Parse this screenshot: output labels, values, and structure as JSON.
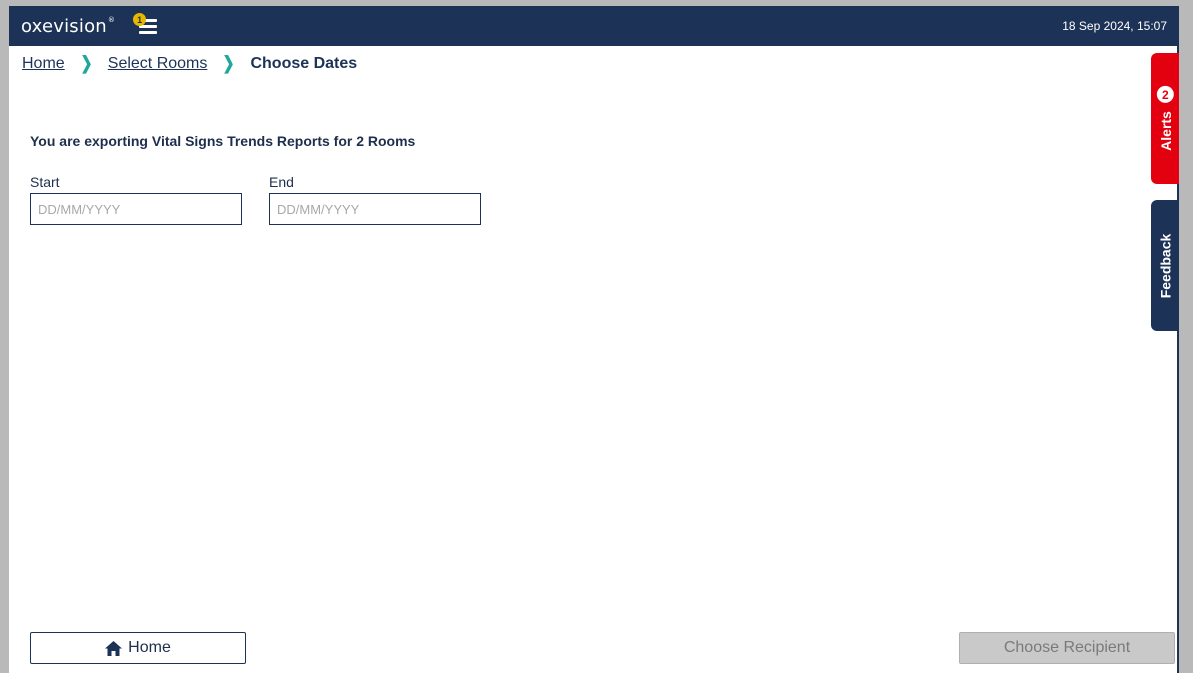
{
  "header": {
    "logo_text": "oxevision",
    "logo_mark": "®",
    "menu_badge": "1",
    "datetime": "18 Sep 2024, 15:07",
    "menu_icon": "hamburger-icon"
  },
  "breadcrumb": {
    "home": "Home",
    "select_rooms": "Select Rooms",
    "current": "Choose Dates",
    "separator": "❯"
  },
  "main": {
    "title": "You are exporting Vital Signs Trends Reports for 2 Rooms",
    "start_label": "Start",
    "start_placeholder": "DD/MM/YYYY",
    "end_label": "End",
    "end_placeholder": "DD/MM/YYYY"
  },
  "side_tabs": {
    "alerts_label": "Alerts",
    "alerts_count": "2",
    "feedback_label": "Feedback"
  },
  "footer": {
    "home_label": "Home",
    "home_icon": "house-icon",
    "next_label": "Choose Recipient"
  },
  "colors": {
    "navy": "#1c3357",
    "accent_teal": "#1fa89a",
    "alert_red": "#e3000f",
    "badge_yellow": "#e8b800"
  }
}
